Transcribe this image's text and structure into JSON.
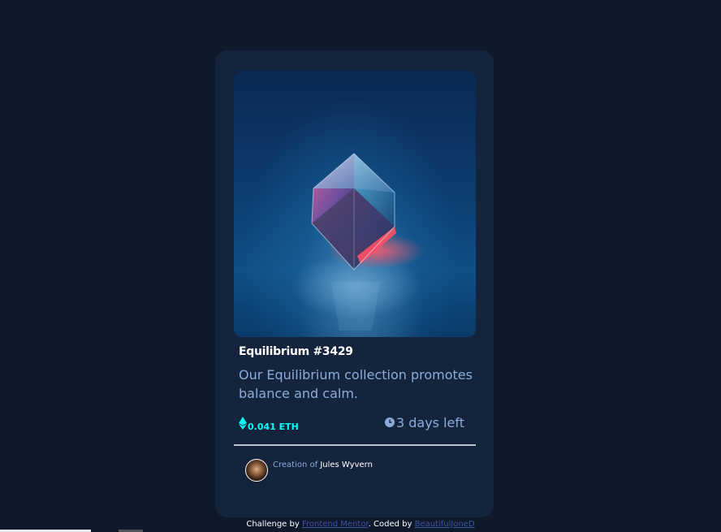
{
  "card": {
    "title": "Equilibrium #3429",
    "description": "Our Equilibrium collection promotes balance and calm.",
    "price": "0.041 ETH",
    "time_left": "3 days left",
    "creator_prefix": "Creation of",
    "creator_name": "Jules Wyvern"
  },
  "footer": {
    "challenge_prefix": "Challenge by ",
    "challenge_link": "Frontend Mentor",
    "coded_prefix": ". Coded by ",
    "coded_link": "BeautifulJoneD"
  },
  "colors": {
    "page_bg": "#0e192c",
    "card_bg": "#15243d",
    "accent_cyan": "#00fff8",
    "soft_blue": "#8bacd9"
  },
  "icons": [
    "ethereum-icon",
    "clock-icon"
  ]
}
